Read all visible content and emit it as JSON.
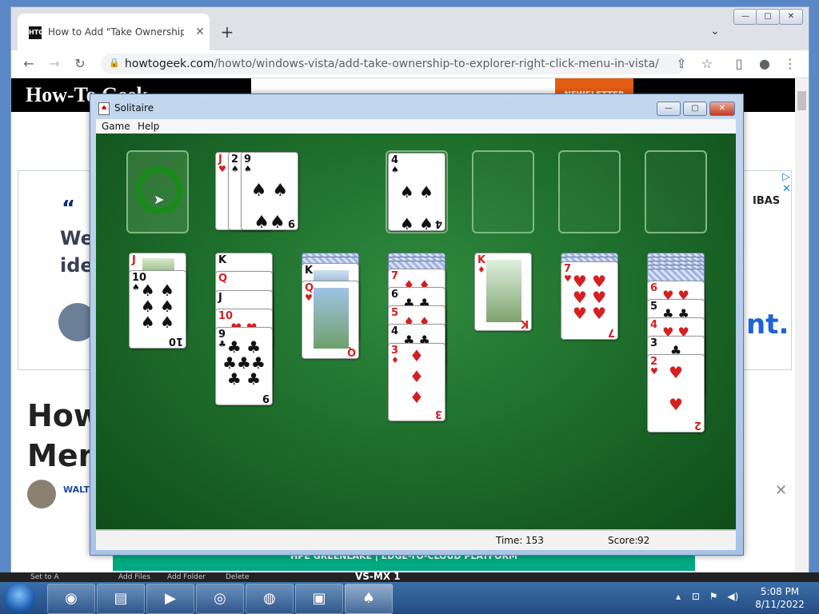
{
  "browser": {
    "tab_title": "How to Add \"Take Ownership\" to",
    "tab_favicon": "HTG",
    "url_host": "howtogeek.com",
    "url_path": "/howto/windows-vista/add-take-ownership-to-explorer-right-click-menu-in-vista/"
  },
  "page": {
    "logo": "How-To Geek",
    "newsletter": "NEWSLETTER",
    "ad_quote": "“",
    "ad_line1": "We i",
    "ad_line2": "iden",
    "ad_right": "IBAS",
    "ad_nt": "nt.",
    "heading_line1": "How",
    "heading_line2": "Men",
    "author": "WALTE",
    "hpe_banner": "HPE GREENLAKE | EDGE-TO-CLOUD PLATFORM",
    "bottom_text": "VS-MX 1",
    "bottom_buttons": [
      "Set to A",
      "Add Files",
      "Add Folder",
      "Delete"
    ]
  },
  "solitaire": {
    "title": "Solitaire",
    "menu": [
      "Game",
      "Help"
    ],
    "time_label": "Time:",
    "time_value": "153",
    "score_label": "Score:",
    "score_value": "92",
    "waste": [
      {
        "rank": "J",
        "suit": "♥"
      },
      {
        "rank": "2",
        "suit": "♠"
      },
      {
        "rank": "9",
        "suit": "♠"
      }
    ],
    "foundations": [
      {
        "rank": "4",
        "suit": "♠"
      }
    ],
    "tableau": [
      [
        "J♠",
        "10♠"
      ],
      [
        "K♣",
        "Q♥",
        "J♣",
        "10♥",
        "9♣"
      ],
      [
        "K♠",
        "Q♥"
      ],
      [
        "7♦",
        "6♣",
        "5♦",
        "4♣",
        "3♦"
      ],
      [
        "K♦"
      ],
      [
        "7♥"
      ],
      [
        "6♥",
        "5♣",
        "4♥",
        "3♣",
        "2♥"
      ]
    ]
  },
  "taskbar": {
    "time": "5:08 PM",
    "date": "8/11/2022"
  }
}
